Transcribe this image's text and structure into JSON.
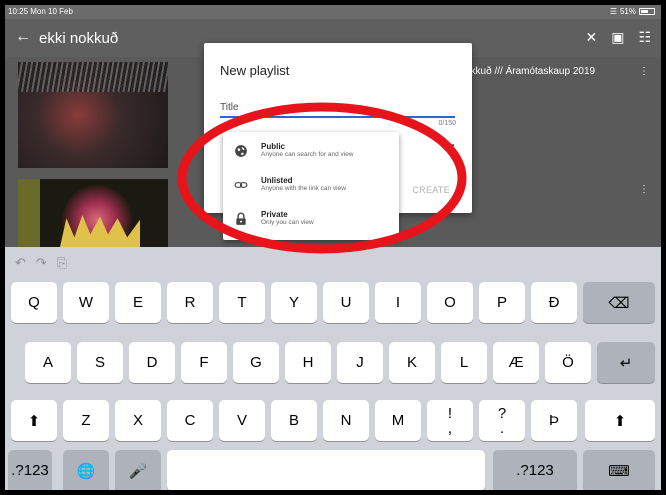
{
  "status_bar": {
    "time": "10:25  Mon 10 Feb",
    "battery": "51%"
  },
  "header": {
    "back_icon": "arrow-left-icon",
    "title": "ekki nokkuð"
  },
  "content": {
    "video_title_partial": "okkuð /// Áramótaskaup 2019"
  },
  "dialog": {
    "title": "New playlist",
    "title_field_label": "Title",
    "counter": "0/150",
    "create_label": "CREATE"
  },
  "privacy_menu": {
    "items": [
      {
        "label": "Public",
        "description": "Anyone can search for and view",
        "icon": "globe-icon"
      },
      {
        "label": "Unlisted",
        "description": "Anyone with the link can view",
        "icon": "link-icon"
      },
      {
        "label": "Private",
        "description": "Only you can view",
        "icon": "lock-icon"
      }
    ]
  },
  "keyboard": {
    "row1": [
      "Q",
      "W",
      "E",
      "R",
      "T",
      "Y",
      "U",
      "I",
      "O",
      "P",
      "Ð"
    ],
    "row2": [
      "A",
      "S",
      "D",
      "F",
      "G",
      "H",
      "J",
      "K",
      "L",
      "Æ",
      "Ö"
    ],
    "row3": [
      "Z",
      "X",
      "C",
      "V",
      "B",
      "N",
      "M",
      "!\n,",
      "?\n.",
      "Þ"
    ],
    "numbers_label": ".?123"
  },
  "colors": {
    "annotation": "#e8141c",
    "focus_line": "#2a66d9"
  }
}
